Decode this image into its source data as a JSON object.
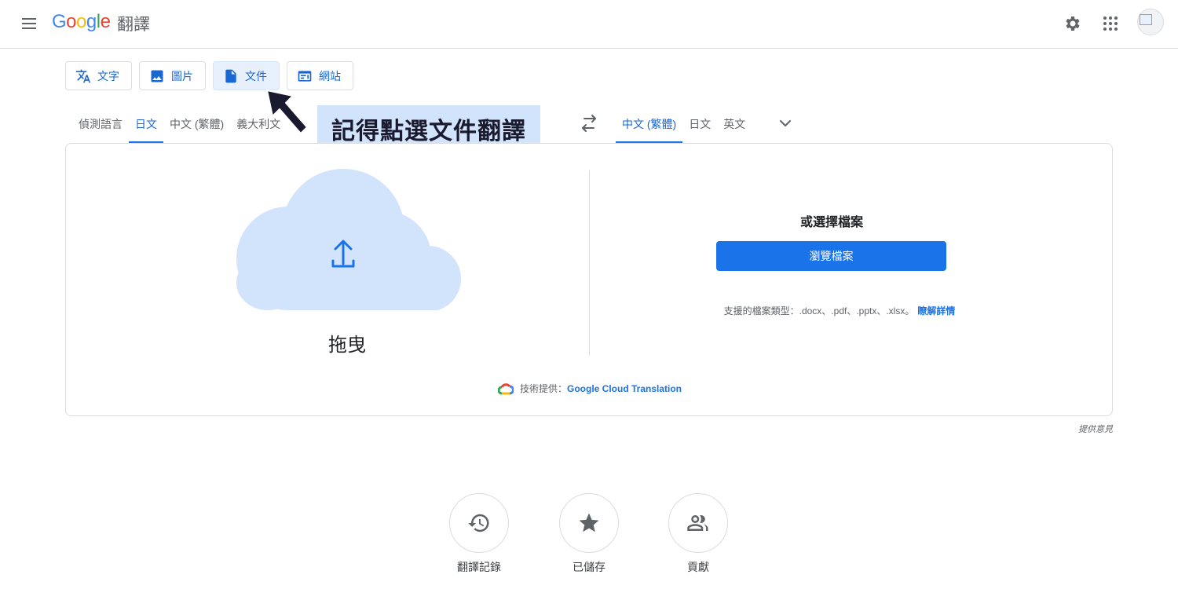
{
  "header": {
    "logo": "Google",
    "product": "翻譯",
    "icons": [
      "menu-icon",
      "gear-icon",
      "apps-grid-icon",
      "avatar"
    ]
  },
  "mode_tabs": [
    {
      "label": "文字",
      "icon": "translate-icon",
      "active": false
    },
    {
      "label": "圖片",
      "icon": "image-icon",
      "active": false
    },
    {
      "label": "文件",
      "icon": "document-icon",
      "active": true
    },
    {
      "label": "網站",
      "icon": "website-icon",
      "active": false
    }
  ],
  "source_langs": [
    "偵測語言",
    "日文",
    "中文 (繁體)",
    "義大利文"
  ],
  "source_active": "日文",
  "target_langs": [
    "中文 (繁體)",
    "日文",
    "英文"
  ],
  "target_active": "中文 (繁體)",
  "annotation": {
    "text": "記得點選文件翻譯"
  },
  "card": {
    "drag_label": "拖曳",
    "choose_title": "或選擇檔案",
    "browse_button": "瀏覽檔案",
    "file_types": "支援的檔案類型：.docx、.pdf、.pptx、.xlsx。",
    "learn_more": "瞭解詳情",
    "powered_prefix": "技術提供：",
    "powered_link": "Google Cloud Translation"
  },
  "feedback": "提供意見",
  "bottom_buttons": [
    {
      "label": "翻譯記錄",
      "icon": "history-icon"
    },
    {
      "label": "已儲存",
      "icon": "star-icon"
    },
    {
      "label": "貢獻",
      "icon": "community-icon"
    }
  ],
  "colors": {
    "accent": "#1a73e8",
    "accent_text": "#1967d2",
    "tab_active_bg": "#e8f0fe",
    "cloud": "#d2e3fc",
    "annotation_bg": "#d2e3fc"
  }
}
